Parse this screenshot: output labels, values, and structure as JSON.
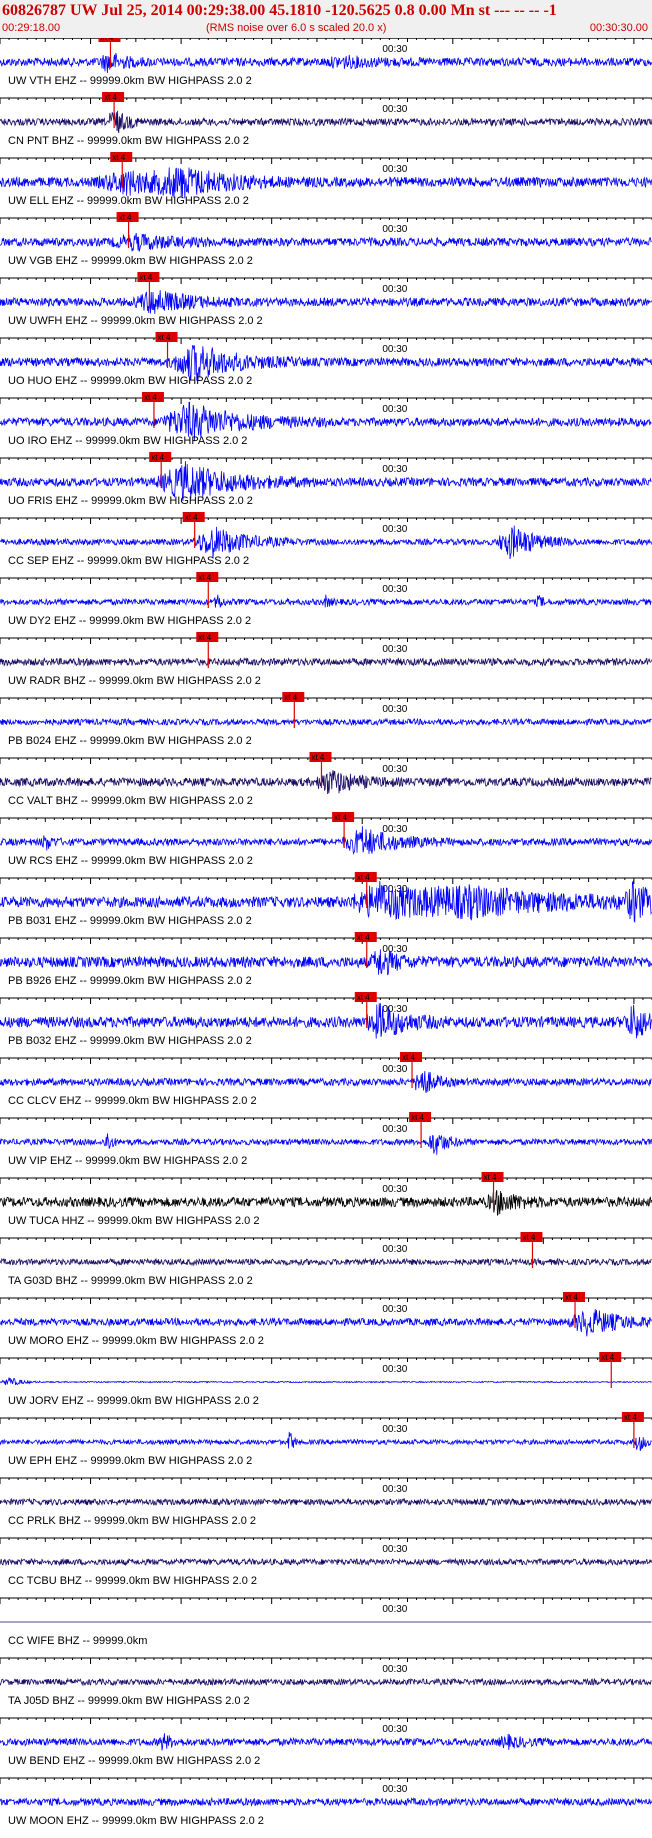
{
  "header": {
    "title": "60826787 UW Jul 25, 2014 00:29:38.00   45.1810 -120.5625  0.8 0.00 Mn st --- -- --   -1",
    "start_time": "00:29:18.00",
    "rms_note": "(RMS noise over 6.0 s scaled 20.0 x)",
    "end_time": "00:30:30.00"
  },
  "colors": {
    "blue": "#0000ff",
    "navy": "#1a0a66",
    "black": "#000000",
    "pick": "#dd0000",
    "tick": "#000000"
  },
  "chart_data": {
    "type": "line",
    "title": "",
    "xlabel": "",
    "ylabel": "",
    "x_range_seconds": [
      0,
      72
    ],
    "mid_tick_label": "00:30",
    "mid_tick_seconds": 42,
    "pick_label": "xt 4",
    "traces": [
      {
        "label": "UW VTH EHZ -- 99999.0km BW  HIGHPASS  2.0  2",
        "color": "blue",
        "amp": 0.35,
        "pick": 12.2,
        "events": [
          [
            12,
            2,
            0.7
          ],
          [
            38,
            4,
            0.3
          ]
        ]
      },
      {
        "label": "CN PNT BHZ -- 99999.0km BW  HIGHPASS  2.0  2",
        "color": "navy",
        "amp": 0.3,
        "pick": 12.6,
        "events": [
          [
            12.6,
            1.5,
            1.0
          ]
        ]
      },
      {
        "label": "UW ELL EHZ -- 99999.0km BW  HIGHPASS  2.0  2",
        "color": "blue",
        "amp": 0.4,
        "pick": 13.5,
        "events": [
          [
            14,
            6,
            0.8
          ],
          [
            20,
            6,
            0.9
          ]
        ]
      },
      {
        "label": "UW VGB EHZ -- 99999.0km BW  HIGHPASS  2.0  2",
        "color": "blue",
        "amp": 0.35,
        "pick": 14.2,
        "events": [
          [
            15,
            5,
            0.5
          ]
        ]
      },
      {
        "label": "UW UWFH EHZ -- 99999.0km BW  HIGHPASS  2.0  2",
        "color": "blue",
        "amp": 0.35,
        "pick": 16.5,
        "events": [
          [
            17,
            4,
            0.9
          ]
        ]
      },
      {
        "label": "UO HUO EHZ -- 99999.0km BW  HIGHPASS  2.0  2",
        "color": "blue",
        "amp": 0.35,
        "pick": 18.5,
        "events": [
          [
            21.5,
            5,
            1.4
          ]
        ]
      },
      {
        "label": "UO IRO EHZ -- 99999.0km BW  HIGHPASS  2.0  2",
        "color": "blue",
        "amp": 0.35,
        "pick": 17.0,
        "events": [
          [
            21,
            6,
            1.4
          ]
        ]
      },
      {
        "label": "UO FRIS EHZ -- 99999.0km BW  HIGHPASS  2.0  2",
        "color": "blue",
        "amp": 0.35,
        "pick": 17.8,
        "events": [
          [
            20.5,
            6,
            1.4
          ]
        ]
      },
      {
        "label": "CC SEP EHZ -- 99999.0km BW  HIGHPASS  2.0  2",
        "color": "blue",
        "amp": 0.25,
        "pick": 21.5,
        "events": [
          [
            23.5,
            4,
            1.2
          ],
          [
            56.5,
            3,
            1.3
          ]
        ]
      },
      {
        "label": "UW DY2 EHZ -- 99999.0km BW  HIGHPASS  2.0  2",
        "color": "blue",
        "amp": 0.25,
        "pick": 23.0,
        "events": [
          [
            24,
            0.6,
            0.6
          ],
          [
            36,
            0.5,
            0.4
          ],
          [
            59.5,
            0.5,
            0.5
          ]
        ]
      },
      {
        "label": "UW RADR BHZ -- 99999.0km BW  HIGHPASS  2.0  2",
        "color": "navy",
        "amp": 0.3,
        "pick": 23.0,
        "events": []
      },
      {
        "label": "PB B024 EHZ -- 99999.0km BW  HIGHPASS  2.0  2",
        "color": "blue",
        "amp": 0.25,
        "pick": 32.5,
        "events": []
      },
      {
        "label": "CC VALT BHZ -- 99999.0km BW  HIGHPASS  2.0  2",
        "color": "navy",
        "amp": 0.35,
        "pick": 35.5,
        "events": [
          [
            36.5,
            3,
            0.9
          ]
        ]
      },
      {
        "label": "UW RCS EHZ -- 99999.0km BW  HIGHPASS  2.0  2",
        "color": "blue",
        "amp": 0.3,
        "pick": 38.0,
        "events": [
          [
            5,
            0.8,
            0.6
          ],
          [
            40,
            4,
            1.1
          ]
        ]
      },
      {
        "label": "PB B031 EHZ -- 99999.0km BW  HIGHPASS  2.0  2",
        "color": "blue",
        "amp": 0.45,
        "pick": 40.5,
        "events": [
          [
            42,
            6,
            1.4
          ],
          [
            52,
            14,
            0.9
          ],
          [
            70,
            2,
            1.3
          ]
        ]
      },
      {
        "label": "PB B926 EHZ -- 99999.0km BW  HIGHPASS  2.0  2",
        "color": "blue",
        "amp": 0.45,
        "pick": 40.5,
        "events": [
          [
            42,
            2,
            1.0
          ]
        ]
      },
      {
        "label": "PB B032 EHZ -- 99999.0km BW  HIGHPASS  2.0  2",
        "color": "blue",
        "amp": 0.45,
        "pick": 40.5,
        "events": [
          [
            42,
            3,
            1.3
          ],
          [
            70,
            2,
            1.3
          ]
        ]
      },
      {
        "label": "CC CLCV EHZ -- 99999.0km BW  HIGHPASS  2.0  2",
        "color": "blue",
        "amp": 0.3,
        "pick": 45.5,
        "events": [
          [
            46.5,
            1.5,
            1.2
          ]
        ]
      },
      {
        "label": "UW VIP EHZ -- 99999.0km BW  HIGHPASS  2.0  2",
        "color": "blue",
        "amp": 0.25,
        "pick": 46.5,
        "events": [
          [
            11.8,
            0.5,
            1.0
          ],
          [
            48,
            1.5,
            1.0
          ]
        ]
      },
      {
        "label": "UW TUCA HHZ -- 99999.0km BW  HIGHPASS  2.0  2",
        "color": "black",
        "amp": 0.4,
        "pick": 54.5,
        "events": [
          [
            55,
            2.5,
            0.8
          ]
        ]
      },
      {
        "label": "TA G03D BHZ -- 99999.0km BW  HIGHPASS  2.0  2",
        "color": "navy",
        "amp": 0.25,
        "pick": 58.8,
        "events": []
      },
      {
        "label": "UW MORO EHZ -- 99999.0km BW  HIGHPASS  2.0  2",
        "color": "blue",
        "amp": 0.3,
        "pick": 63.5,
        "events": [
          [
            65,
            4,
            1.0
          ]
        ]
      },
      {
        "label": "UW JORV EHZ -- 99999.0km BW  HIGHPASS  2.0  2",
        "color": "blue",
        "amp": 0.05,
        "pick": 67.5,
        "events": [
          [
            1,
            1.5,
            0.4
          ]
        ]
      },
      {
        "label": "UW EPH EHZ -- 99999.0km BW  HIGHPASS  2.0  2",
        "color": "blue",
        "amp": 0.2,
        "pick": 70.0,
        "events": [
          [
            32,
            0.5,
            0.9
          ],
          [
            70.5,
            0.8,
            0.8
          ]
        ]
      },
      {
        "label": "CC PRLK BHZ -- 99999.0km BW  HIGHPASS  2.0  2",
        "color": "navy",
        "amp": 0.25,
        "pick": null,
        "events": []
      },
      {
        "label": "CC TCBU BHZ -- 99999.0km BW  HIGHPASS  2.0  2",
        "color": "navy",
        "amp": 0.25,
        "pick": null,
        "events": []
      },
      {
        "label": "CC WIFE BHZ -- 99999.0km",
        "color": "navy",
        "amp": 0.0,
        "pick": null,
        "events": []
      },
      {
        "label": "TA J05D BHZ -- 99999.0km BW  HIGHPASS  2.0  2",
        "color": "navy",
        "amp": 0.25,
        "pick": null,
        "events": []
      },
      {
        "label": "UW BEND EHZ -- 99999.0km BW  HIGHPASS  2.0  2",
        "color": "blue",
        "amp": 0.3,
        "pick": null,
        "events": [
          [
            18,
            1,
            0.6
          ],
          [
            56,
            2,
            0.4
          ]
        ]
      },
      {
        "label": "UW MOON EHZ -- 99999.0km BW  HIGHPASS  2.0  2",
        "color": "blue",
        "amp": 0.3,
        "pick": null,
        "events": []
      }
    ]
  }
}
